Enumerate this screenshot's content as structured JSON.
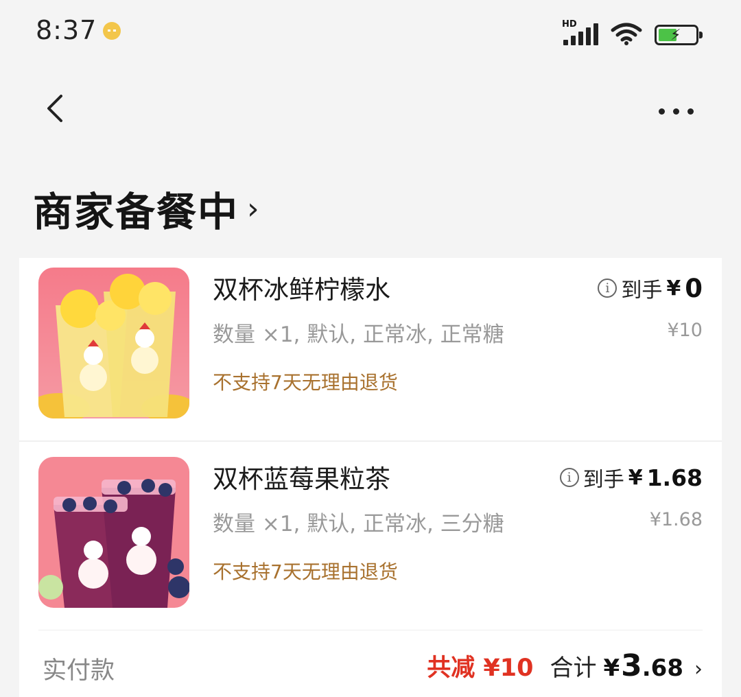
{
  "status_bar": {
    "time": "8:37",
    "network_label": "HD",
    "icons": [
      "notification-icon",
      "signal-icon",
      "wifi-icon",
      "battery-charging-icon"
    ]
  },
  "nav": {
    "back_icon": "chevron-left-icon",
    "more_icon": "more-horizontal-icon"
  },
  "order": {
    "status_title": "商家备餐中",
    "status_chevron": "›"
  },
  "items": [
    {
      "name": "双杯冰鲜柠檬水",
      "spec": "数量 ×1, 默认, 正常冰, 正常糖",
      "note": "不支持7天无理由退货",
      "final_label": "到手",
      "final_yen": "¥",
      "final_price": "0",
      "original_price": "¥10",
      "thumb_colors": {
        "bg": "#f47b86",
        "drink": "#f7e067",
        "accent": "#ffd43a"
      }
    },
    {
      "name": "双杯蓝莓果粒茶",
      "spec": "数量 ×1, 默认, 正常冰, 三分糖",
      "note": "不支持7天无理由退货",
      "final_label": "到手",
      "final_yen": "¥",
      "final_price": "1.68",
      "original_price": "¥1.68",
      "thumb_colors": {
        "bg": "#f27b86",
        "drink": "#7a2254",
        "accent": "#2e3568"
      }
    }
  ],
  "summary": {
    "label": "实付款",
    "discount": "共减 ¥10",
    "total_label": "合计",
    "total_yen": "¥",
    "total_int": "3",
    "total_dec": ".68",
    "chevron": "›"
  },
  "colors": {
    "discount": "#e03222",
    "note": "#a8712e",
    "background": "#f4f4f4"
  }
}
